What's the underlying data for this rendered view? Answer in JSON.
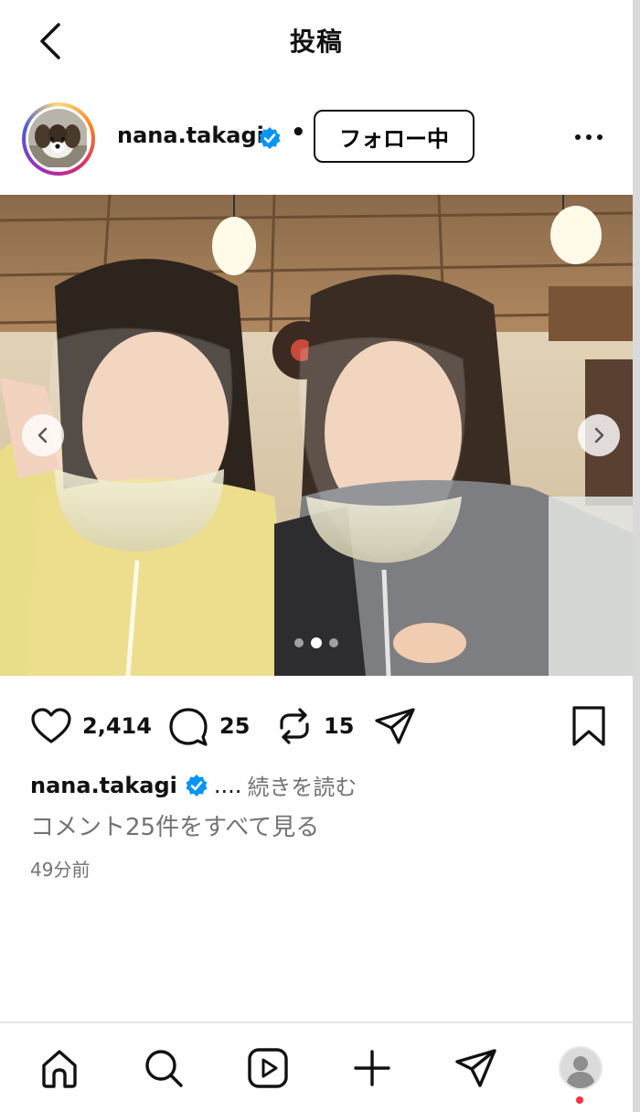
{
  "header": {
    "title": "投稿"
  },
  "author": {
    "username": "nana.takagi",
    "separator": "•",
    "follow_label": "フォロー中"
  },
  "post": {
    "carousel": {
      "dot_count": 3,
      "active_index": 1
    },
    "likes": "2,414",
    "comments": "25",
    "reposts": "15"
  },
  "caption": {
    "username": "nana.takagi",
    "ellipsis": "....",
    "read_more": "続きを読む"
  },
  "view_comments": "コメント25件をすべて見る",
  "timestamp": "49分前",
  "colors": {
    "verified": "#0095f6",
    "notification": "#ff3040",
    "muted": "#737373"
  },
  "icons": [
    "back-icon",
    "verified-icon",
    "more-icon",
    "heart-icon",
    "comment-icon",
    "repost-icon",
    "share-icon",
    "bookmark-icon",
    "home-icon",
    "search-icon",
    "reels-icon",
    "create-icon",
    "messages-icon",
    "profile-icon"
  ]
}
